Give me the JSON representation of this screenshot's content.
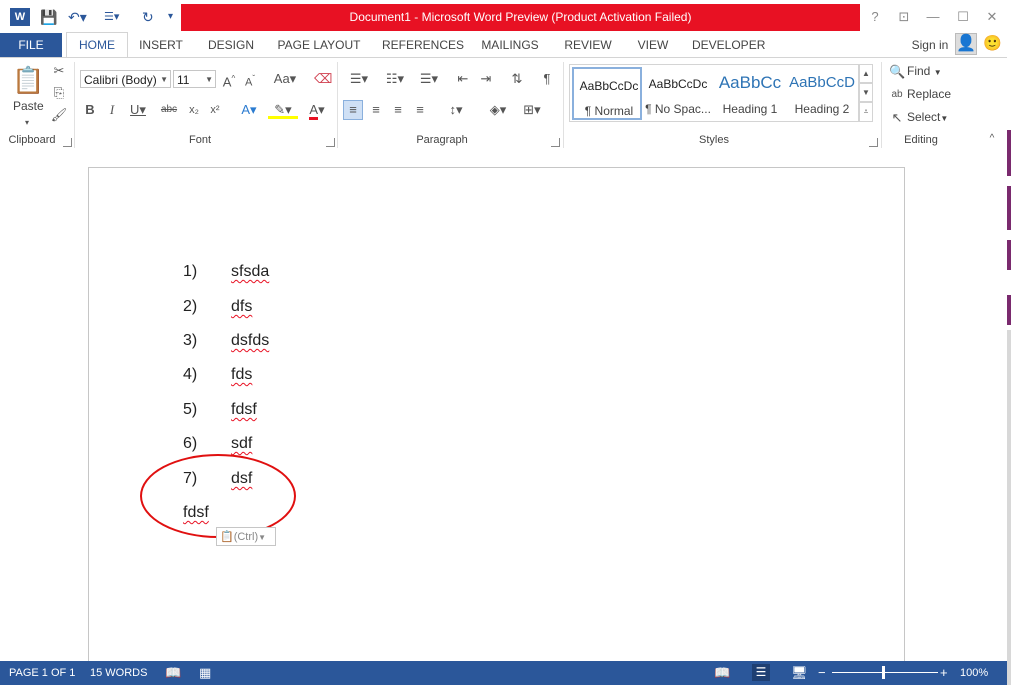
{
  "titlebar": {
    "title": "Document1 -  Microsoft Word Preview (Product Activation Failed)",
    "help": "?",
    "restore": "⊡",
    "minimize": "—",
    "maximize": "☐",
    "close": "✕"
  },
  "tabs": {
    "file": "FILE",
    "items": [
      "HOME",
      "INSERT",
      "DESIGN",
      "PAGE LAYOUT",
      "REFERENCES",
      "MAILINGS",
      "REVIEW",
      "VIEW",
      "DEVELOPER"
    ],
    "sign_in": "Sign in"
  },
  "ribbon": {
    "clipboard": {
      "label": "Clipboard",
      "paste": "Paste"
    },
    "font": {
      "label": "Font",
      "font_name": "Calibri (Body)",
      "font_size": "11"
    },
    "paragraph": {
      "label": "Paragraph"
    },
    "styles": {
      "label": "Styles",
      "items": [
        {
          "preview": "AaBbCcDc",
          "name": "¶ Normal"
        },
        {
          "preview": "AaBbCcDc",
          "name": "¶ No Spac..."
        },
        {
          "preview": "AaBbCc",
          "name": "Heading 1"
        },
        {
          "preview": "AaBbCcD",
          "name": "Heading 2"
        }
      ]
    },
    "editing": {
      "label": "Editing",
      "find": "Find",
      "replace": "Replace",
      "select": "Select"
    }
  },
  "document": {
    "list": [
      {
        "num": "1)",
        "text": "sfsda"
      },
      {
        "num": "2)",
        "text": "dfs"
      },
      {
        "num": "3)",
        "text": "dsfds"
      },
      {
        "num": "4)",
        "text": "fds"
      },
      {
        "num": "5)",
        "text": "fdsf"
      },
      {
        "num": "6)",
        "text": "sdf"
      },
      {
        "num": "7)",
        "text": "dsf"
      }
    ],
    "trailing_text": "fdsf",
    "paste_options": "(Ctrl)"
  },
  "status": {
    "page": "PAGE 1 OF 1",
    "words": "15 WORDS",
    "zoom": "100%"
  },
  "colors": {
    "accent": "#2b579a",
    "title_bar": "#e81123",
    "annotation_circle": "#e01010"
  }
}
